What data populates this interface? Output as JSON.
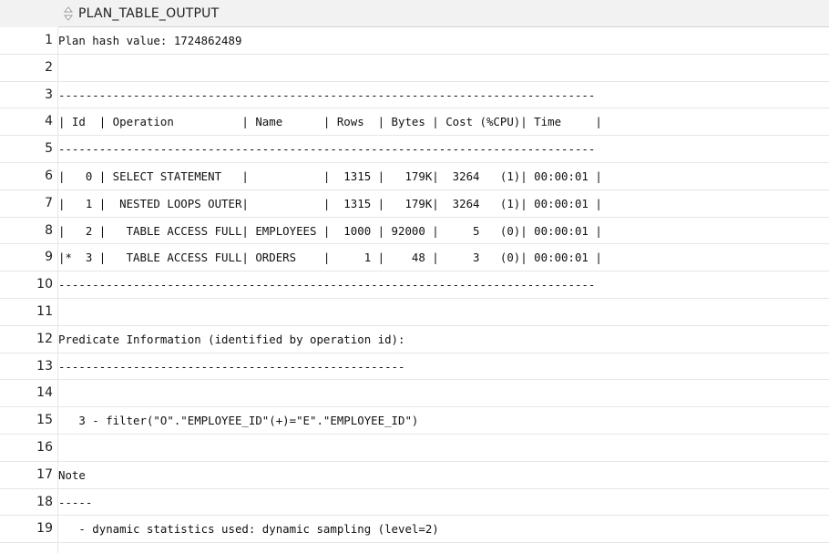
{
  "column": {
    "title": "PLAN_TABLE_OUTPUT",
    "icon": "sort-icon"
  },
  "rows": [
    {
      "num": "1",
      "text": "Plan hash value: 1724862489"
    },
    {
      "num": "2",
      "text": ""
    },
    {
      "num": "3",
      "text": "-------------------------------------------------------------------------------"
    },
    {
      "num": "4",
      "text": "| Id  | Operation          | Name      | Rows  | Bytes | Cost (%CPU)| Time     |"
    },
    {
      "num": "5",
      "text": "-------------------------------------------------------------------------------"
    },
    {
      "num": "6",
      "text": "|   0 | SELECT STATEMENT   |           |  1315 |   179K|  3264   (1)| 00:00:01 |"
    },
    {
      "num": "7",
      "text": "|   1 |  NESTED LOOPS OUTER|           |  1315 |   179K|  3264   (1)| 00:00:01 |"
    },
    {
      "num": "8",
      "text": "|   2 |   TABLE ACCESS FULL| EMPLOYEES |  1000 | 92000 |     5   (0)| 00:00:01 |"
    },
    {
      "num": "9",
      "text": "|*  3 |   TABLE ACCESS FULL| ORDERS    |     1 |    48 |     3   (0)| 00:00:01 |"
    },
    {
      "num": "10",
      "text": "-------------------------------------------------------------------------------"
    },
    {
      "num": "11",
      "text": ""
    },
    {
      "num": "12",
      "text": "Predicate Information (identified by operation id):"
    },
    {
      "num": "13",
      "text": "---------------------------------------------------"
    },
    {
      "num": "14",
      "text": ""
    },
    {
      "num": "15",
      "text": "   3 - filter(\"O\".\"EMPLOYEE_ID\"(+)=\"E\".\"EMPLOYEE_ID\")"
    },
    {
      "num": "16",
      "text": ""
    },
    {
      "num": "17",
      "text": "Note"
    },
    {
      "num": "18",
      "text": "-----"
    },
    {
      "num": "19",
      "text": "   - dynamic statistics used: dynamic sampling (level=2)"
    }
  ]
}
